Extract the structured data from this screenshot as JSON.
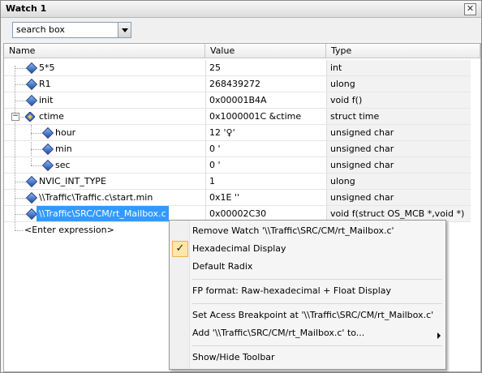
{
  "window": {
    "title": "Watch 1"
  },
  "toolbar": {
    "search_value": "search box"
  },
  "columns": {
    "name": "Name",
    "value": "Value",
    "type": "Type"
  },
  "rows": [
    {
      "name": "5*5",
      "value": "25",
      "type": "int",
      "icon": "variable-diamond-icon"
    },
    {
      "name": "R1",
      "value": "268439272",
      "type": "ulong",
      "icon": "variable-diamond-icon"
    },
    {
      "name": "init",
      "value": "0x00001B4A",
      "type": "void f()",
      "icon": "variable-diamond-icon"
    },
    {
      "name": "ctime",
      "value": "0x1000001C &ctime",
      "type": "struct time",
      "icon": "struct-icon",
      "expanded": true
    },
    {
      "name": "hour",
      "value": "12 '♀'",
      "type": "unsigned char",
      "icon": "variable-diamond-icon",
      "child": true
    },
    {
      "name": "min",
      "value": "0 '",
      "type": "unsigned char",
      "icon": "variable-diamond-icon",
      "child": true
    },
    {
      "name": "sec",
      "value": "0 '",
      "type": "unsigned char",
      "icon": "variable-diamond-icon",
      "child": true
    },
    {
      "name": "NVIC_INT_TYPE",
      "value": "1",
      "type": "ulong",
      "icon": "variable-diamond-icon"
    },
    {
      "name": "\\\\Traffic\\Traffic.c\\start.min",
      "value": "0x1E ''",
      "type": "unsigned char",
      "icon": "variable-diamond-icon"
    },
    {
      "name": "\\\\Traffic\\SRC/CM/rt_Mailbox.c",
      "value": "0x00002C30",
      "type": "void f(struct OS_MCB *,void *)",
      "icon": "variable-diamond-icon",
      "selected": true
    }
  ],
  "enter_expression": "<Enter expression>",
  "context_menu": {
    "items": [
      {
        "label": "Remove Watch '\\\\Traffic\\SRC/CM/rt_Mailbox.c'"
      },
      {
        "label": "Hexadecimal Display",
        "checked": true
      },
      {
        "label": "Default Radix"
      },
      {
        "label": "FP format: Raw-hexadecimal + Float Display"
      },
      {
        "label": "Set Acess Breakpoint at '\\\\Traffic\\SRC/CM/rt_Mailbox.c'"
      },
      {
        "label": "Add '\\\\Traffic\\SRC/CM/rt_Mailbox.c' to...",
        "submenu": true
      },
      {
        "label": "Show/Hide Toolbar"
      }
    ]
  },
  "colors": {
    "selection": "#3399ff",
    "check_bg": "#fde6a8"
  }
}
